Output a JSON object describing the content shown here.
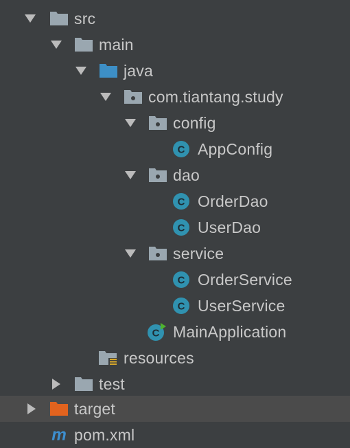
{
  "tree": {
    "items": [
      {
        "label": "src",
        "icon": "folder-icon",
        "expanded": true
      },
      {
        "label": "main",
        "icon": "folder-icon",
        "expanded": true
      },
      {
        "label": "java",
        "icon": "source-folder-icon",
        "expanded": true
      },
      {
        "label": "com.tiantang.study",
        "icon": "package-icon",
        "expanded": true
      },
      {
        "label": "config",
        "icon": "package-icon",
        "expanded": true
      },
      {
        "label": "AppConfig",
        "icon": "class-icon"
      },
      {
        "label": "dao",
        "icon": "package-icon",
        "expanded": true
      },
      {
        "label": "OrderDao",
        "icon": "class-icon"
      },
      {
        "label": "UserDao",
        "icon": "class-icon"
      },
      {
        "label": "service",
        "icon": "package-icon",
        "expanded": true
      },
      {
        "label": "OrderService",
        "icon": "class-icon"
      },
      {
        "label": "UserService",
        "icon": "class-icon"
      },
      {
        "label": "MainApplication",
        "icon": "runnable-class-icon"
      },
      {
        "label": "resources",
        "icon": "resources-folder-icon"
      },
      {
        "label": "test",
        "icon": "folder-icon",
        "expanded": false
      },
      {
        "label": "target",
        "icon": "excluded-folder-icon",
        "expanded": false,
        "selected": true
      },
      {
        "label": "pom.xml",
        "icon": "maven-icon"
      }
    ]
  },
  "colors": {
    "background": "#3c3f41",
    "selected_row": "#4b4b4b",
    "text": "#c8c8c8",
    "folder": "#9aa7b0",
    "source_folder": "#3d8fc6",
    "excluded_folder": "#e2631e",
    "class_icon": "#3092b0",
    "run_marker": "#4fb22e",
    "maven": "#3d8fd0"
  }
}
